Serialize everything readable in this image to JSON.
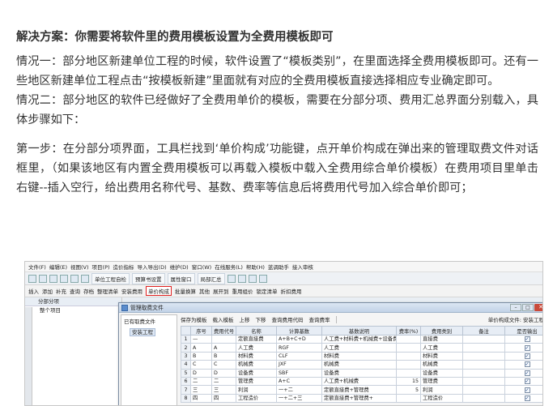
{
  "article": {
    "heading": "解决方案：你需要将软件里的费用模板设置为全费用模板即可",
    "paragraphs": [
      "情况一：部分地区新建单位工程的时候，软件设置了“模板类别”，在里面选择全费用模板即可。还有一些地区新建单位工程点击“按模板新建”里面就有对应的全费用模板直接选择相应专业确定即可。",
      "情况二：部分地区的软件已经做好了全费用单价的模板，需要在分部分项、费用汇总界面分别载入，具体步骤如下：",
      "第一步：在分部分项界面，工具栏找到‘单价构成’功能键，点开单价构成在弹出来的管理取费文件对话框里，（如果该地区有内置全费用模板可以再载入模板中载入全费用综合单价模板）在费用项目里单击右键--插入空行，给出费用名称代号、基数、费率等信息后将费用代号加入综合单价即可；"
    ]
  },
  "screenshot": {
    "menu": [
      "文件(F)",
      "编辑(E)",
      "视图(V)",
      "项目(P)",
      "造价指标",
      "导入导出(D)",
      "维护(D)",
      "窗口(W)",
      "在线服务(L)",
      "帮助(H)",
      "蓝调助手",
      "接入审核"
    ],
    "toolbar1": [
      "单位工程自检",
      "预算书设置",
      "属性窗口",
      "局部汇总",
      "费用查看",
      "局部汇总"
    ],
    "toolbar2": [
      "插入",
      "添加",
      "补充",
      "查询",
      "存档",
      "整理清单",
      "安装费用",
      "单价构成",
      "批量换算",
      "其他",
      "展开到",
      "重用组价",
      "锁定清单",
      "折扣费用"
    ],
    "highlighted_tool": "单价构成",
    "left_panel_title": "分部分项",
    "left_panel_item": "整个项目",
    "grid_headers": [
      "编码",
      "类别",
      "名称",
      "清单工程内容",
      "项目特征",
      "单位",
      "含量",
      "工程量",
      "单价"
    ],
    "dialog": {
      "title": "管理取费文件",
      "tree_root": "已有取费文件",
      "tree_child": "安装工程",
      "tools": [
        "保存为模板",
        "载入模板",
        "上移",
        "下移",
        "查询费用代码",
        "查询费率"
      ],
      "file_label": "单价构成文件: 安装工程",
      "columns": [
        "序号",
        "费用代号",
        "名称",
        "计算基数",
        "基数说明",
        "费率(%)",
        "费用类别",
        "备注",
        "是否输出"
      ],
      "rows": [
        [
          "1",
          "—",
          "",
          "定额直接费",
          "A+B+C+D",
          "人工费+材料费+机械费+设备费",
          "",
          "直接费",
          "",
          "✓"
        ],
        [
          "2",
          "A",
          "A",
          "人工费",
          "RGF",
          "人工费",
          "",
          "人工费",
          "",
          "✓"
        ],
        [
          "3",
          "B",
          "B",
          "材料费",
          "CLF",
          "材料费",
          "",
          "材料费",
          "",
          "✓"
        ],
        [
          "4",
          "C",
          "C",
          "机械费",
          "JXF",
          "机械费",
          "",
          "机械费",
          "",
          "✓"
        ],
        [
          "5",
          "D",
          "D",
          "设备费",
          "SBF",
          "设备费",
          "",
          "设备费",
          "",
          "✓"
        ],
        [
          "6",
          "二",
          "二",
          "管理费",
          "A+C",
          "人工费+机械费",
          "15",
          "管理费",
          "",
          "✓"
        ],
        [
          "7",
          "三",
          "三",
          "利润",
          "一+二",
          "定额直接费+管理费",
          "5",
          "利润",
          "",
          "✓"
        ],
        [
          "8",
          "四",
          "四",
          "工程造价",
          "一+二+三",
          "定额直接费+管理费+",
          "",
          "工程造价",
          "",
          "✓"
        ]
      ]
    }
  }
}
